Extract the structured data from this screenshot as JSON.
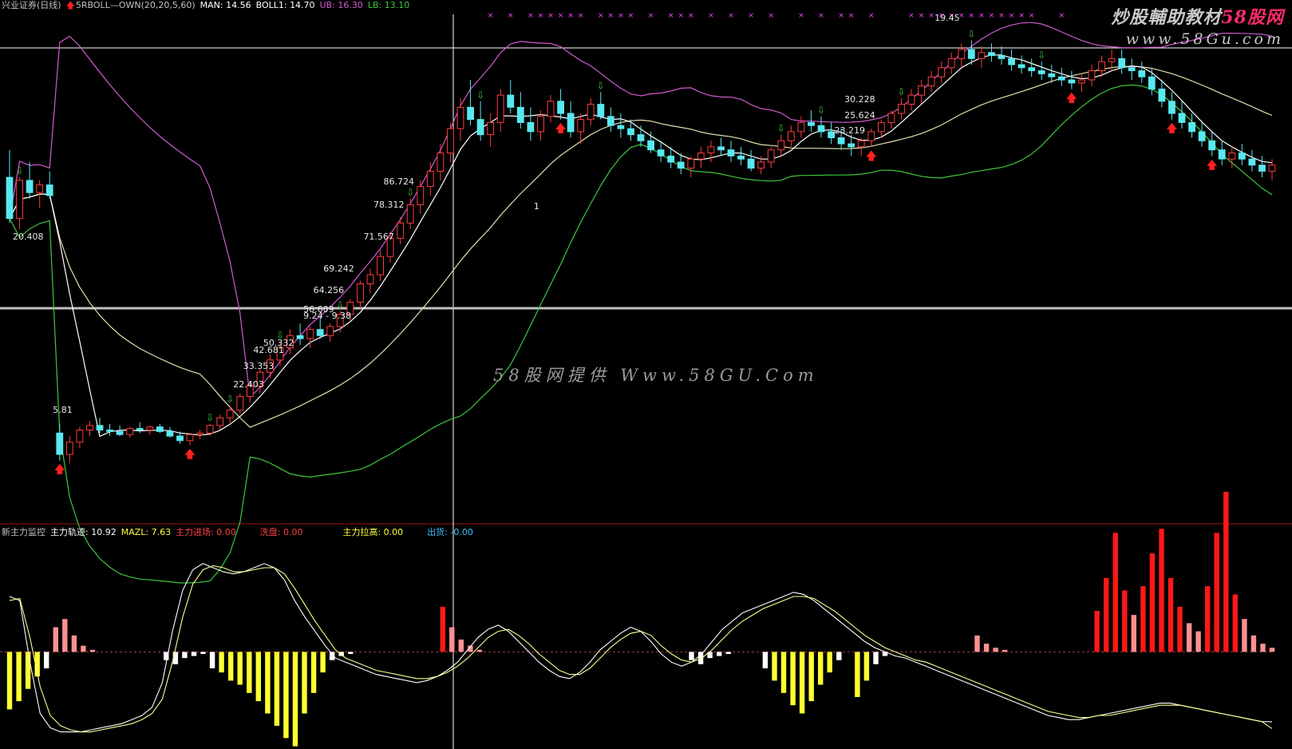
{
  "header": {
    "stock_name": "兴业证券(日线)",
    "indicator_name": "5RBOLL—OWN(20,20,5,60)",
    "man": "MAN: 14.56",
    "boll1": "BOLL1: 14.70",
    "ub": "UB: 16.30",
    "lb": "LB: 13.10"
  },
  "indicator_header": {
    "name": "新主力监控",
    "track": "主力轨迹: 10.92",
    "mazl": "MAZL: 7.63",
    "enter": "主力进场: 0.00",
    "washout": "洗盘: 0.00",
    "pullup": "主力拉高: 0.00",
    "ship": "出货: -0.00"
  },
  "watermarks": {
    "corner_line1_a": "炒股輔助教材",
    "corner_line1_b": "58股网",
    "corner_line2": "www.58Gu.com",
    "center": "58股网提供 Www.58GU.Com"
  },
  "colors": {
    "background": "#000000",
    "header_label": "#c0c0c0",
    "man": "#ffffff",
    "boll1": "#ffffff",
    "ub": "#d25ad2",
    "lb": "#3cc83c",
    "mid_line": "#e0e0b0",
    "up_candle": "#ff3c3c",
    "down_candle": "#58e8f0",
    "arrow_up": "#ff2020",
    "arrow_down": "#40c040",
    "x_marker": "#ff40ff",
    "red_bar": "#ff1818",
    "pink_bar": "#ff9090",
    "yellow_bar": "#ffff30",
    "white_bar": "#ffffff",
    "separator": "#a01818",
    "crosshair": "#ffffff",
    "price_cursor": "#c0c0c0",
    "enter": "#ff4040",
    "washout": "#ff4040",
    "pullup": "#ffff40",
    "ship": "#40c0ff"
  },
  "price_annotations": [
    "20.408",
    "5.81",
    "22.403",
    "33.353",
    "42.681",
    "50.332",
    "56.609",
    "9.24 - 9.38",
    "64.256",
    "69.242",
    "71.567",
    "78.312",
    "86.724",
    "1",
    "30.228",
    "25.624",
    "23.219",
    "19.45"
  ],
  "chart_data": [
    {
      "type": "candlestick",
      "title": "5RBOLL—OWN(20,20,5,60)",
      "units": "price (pixel-estimated; axis labels not shown)",
      "bands": [
        "UB",
        "BOLL1",
        "LB",
        "MAN"
      ],
      "candles": [
        [
          15.7,
          16.6,
          14.2,
          14.35
        ],
        [
          14.35,
          15.7,
          14.0,
          15.6
        ],
        [
          15.6,
          16.2,
          15.0,
          15.2
        ],
        [
          15.2,
          15.6,
          14.7,
          15.45
        ],
        [
          15.45,
          15.9,
          15.0,
          15.1
        ],
        [
          7.3,
          7.6,
          6.4,
          6.6
        ],
        [
          6.6,
          7.2,
          6.3,
          7.0
        ],
        [
          7.0,
          7.5,
          6.8,
          7.4
        ],
        [
          7.4,
          7.7,
          7.2,
          7.55
        ],
        [
          7.55,
          7.8,
          7.3,
          7.4
        ],
        [
          7.4,
          7.6,
          7.2,
          7.35
        ],
        [
          7.35,
          7.55,
          7.2,
          7.25
        ],
        [
          7.25,
          7.5,
          7.15,
          7.45
        ],
        [
          7.45,
          7.65,
          7.3,
          7.4
        ],
        [
          7.4,
          7.55,
          7.25,
          7.5
        ],
        [
          7.5,
          7.6,
          7.3,
          7.35
        ],
        [
          7.35,
          7.5,
          7.15,
          7.2
        ],
        [
          7.2,
          7.35,
          6.95,
          7.05
        ],
        [
          7.05,
          7.3,
          6.9,
          7.25
        ],
        [
          7.25,
          7.4,
          7.1,
          7.3
        ],
        [
          7.3,
          7.6,
          7.2,
          7.55
        ],
        [
          7.55,
          7.9,
          7.4,
          7.8
        ],
        [
          7.8,
          8.2,
          7.6,
          8.05
        ],
        [
          8.05,
          8.6,
          7.9,
          8.5
        ],
        [
          8.5,
          9.0,
          8.3,
          8.85
        ],
        [
          8.85,
          9.4,
          8.6,
          9.3
        ],
        [
          9.3,
          9.9,
          9.1,
          9.7
        ],
        [
          9.7,
          10.3,
          9.5,
          10.1
        ],
        [
          10.1,
          10.7,
          9.9,
          10.5
        ],
        [
          10.5,
          10.9,
          10.2,
          10.4
        ],
        [
          10.4,
          10.8,
          10.1,
          10.7
        ],
        [
          10.7,
          11.1,
          10.4,
          10.5
        ],
        [
          10.5,
          10.9,
          10.3,
          10.8
        ],
        [
          10.8,
          11.3,
          10.6,
          11.2
        ],
        [
          11.2,
          11.7,
          11.0,
          11.6
        ],
        [
          11.6,
          12.3,
          11.4,
          12.2
        ],
        [
          12.2,
          12.7,
          11.9,
          12.5
        ],
        [
          12.5,
          13.3,
          12.3,
          13.1
        ],
        [
          13.1,
          13.9,
          12.9,
          13.7
        ],
        [
          13.7,
          14.4,
          13.5,
          14.2
        ],
        [
          14.2,
          15.0,
          14.0,
          14.8
        ],
        [
          14.8,
          15.6,
          14.5,
          15.4
        ],
        [
          15.4,
          16.2,
          15.1,
          15.9
        ],
        [
          15.9,
          16.8,
          15.6,
          16.5
        ],
        [
          16.5,
          17.5,
          16.2,
          17.3
        ],
        [
          17.3,
          18.3,
          16.9,
          18.0
        ],
        [
          18.0,
          18.9,
          17.4,
          17.6
        ],
        [
          17.6,
          18.2,
          16.9,
          17.1
        ],
        [
          17.1,
          17.8,
          16.7,
          17.5
        ],
        [
          17.5,
          18.6,
          17.2,
          18.4
        ],
        [
          18.4,
          18.9,
          17.8,
          18.0
        ],
        [
          18.0,
          18.5,
          17.3,
          17.5
        ],
        [
          17.5,
          18.0,
          16.9,
          17.2
        ],
        [
          17.2,
          17.9,
          16.9,
          17.7
        ],
        [
          17.7,
          18.4,
          17.5,
          18.2
        ],
        [
          18.2,
          18.6,
          17.6,
          17.8
        ],
        [
          17.8,
          18.2,
          17.0,
          17.2
        ],
        [
          17.2,
          17.8,
          16.8,
          17.6
        ],
        [
          17.6,
          18.3,
          17.4,
          18.1
        ],
        [
          18.1,
          18.5,
          17.6,
          17.7
        ],
        [
          17.7,
          18.0,
          17.2,
          17.4
        ],
        [
          17.4,
          17.8,
          17.0,
          17.3
        ],
        [
          17.3,
          17.6,
          16.9,
          17.1
        ],
        [
          17.1,
          17.4,
          16.7,
          16.9
        ],
        [
          16.9,
          17.2,
          16.5,
          16.6
        ],
        [
          16.6,
          16.9,
          16.2,
          16.4
        ],
        [
          16.4,
          16.7,
          16.0,
          16.2
        ],
        [
          16.2,
          16.5,
          15.8,
          16.0
        ],
        [
          16.0,
          16.4,
          15.7,
          16.3
        ],
        [
          16.3,
          16.7,
          16.0,
          16.5
        ],
        [
          16.5,
          16.9,
          16.2,
          16.7
        ],
        [
          16.7,
          17.0,
          16.4,
          16.6
        ],
        [
          16.6,
          16.9,
          16.2,
          16.4
        ],
        [
          16.4,
          16.7,
          16.1,
          16.3
        ],
        [
          16.3,
          16.6,
          15.9,
          16.0
        ],
        [
          16.0,
          16.4,
          15.8,
          16.2
        ],
        [
          16.2,
          16.7,
          16.0,
          16.6
        ],
        [
          16.6,
          17.1,
          16.4,
          16.9
        ],
        [
          16.9,
          17.4,
          16.7,
          17.2
        ],
        [
          17.2,
          17.7,
          17.0,
          17.5
        ],
        [
          17.5,
          17.9,
          17.2,
          17.4
        ],
        [
          17.4,
          17.7,
          17.0,
          17.2
        ],
        [
          17.2,
          17.5,
          16.8,
          17.0
        ],
        [
          17.0,
          17.3,
          16.6,
          16.8
        ],
        [
          16.8,
          17.1,
          16.4,
          16.7
        ],
        [
          16.7,
          17.0,
          16.4,
          16.9
        ],
        [
          16.9,
          17.3,
          16.7,
          17.2
        ],
        [
          17.2,
          17.6,
          17.0,
          17.5
        ],
        [
          17.5,
          17.9,
          17.3,
          17.8
        ],
        [
          17.8,
          18.3,
          17.6,
          18.1
        ],
        [
          18.1,
          18.6,
          17.9,
          18.4
        ],
        [
          18.4,
          18.9,
          18.1,
          18.7
        ],
        [
          18.7,
          19.2,
          18.5,
          19.0
        ],
        [
          19.0,
          19.5,
          18.8,
          19.3
        ],
        [
          19.3,
          19.8,
          19.1,
          19.6
        ],
        [
          19.6,
          20.1,
          19.3,
          19.9
        ],
        [
          19.9,
          20.2,
          19.4,
          19.6
        ],
        [
          19.6,
          20.0,
          19.3,
          19.8
        ],
        [
          19.8,
          20.1,
          19.5,
          19.7
        ],
        [
          19.7,
          20.0,
          19.4,
          19.6
        ],
        [
          19.6,
          19.9,
          19.2,
          19.4
        ],
        [
          19.4,
          19.7,
          19.1,
          19.3
        ],
        [
          19.3,
          19.6,
          19.0,
          19.2
        ],
        [
          19.2,
          19.5,
          18.9,
          19.1
        ],
        [
          19.1,
          19.4,
          18.8,
          19.0
        ],
        [
          19.0,
          19.3,
          18.7,
          18.9
        ],
        [
          18.9,
          19.2,
          18.6,
          18.8
        ],
        [
          18.8,
          19.1,
          18.5,
          18.9
        ],
        [
          18.9,
          19.4,
          18.7,
          19.2
        ],
        [
          19.2,
          19.7,
          19.0,
          19.5
        ],
        [
          19.5,
          19.9,
          19.2,
          19.6
        ],
        [
          19.6,
          19.9,
          19.1,
          19.3
        ],
        [
          19.3,
          19.6,
          18.9,
          19.2
        ],
        [
          19.2,
          19.5,
          18.8,
          19.0
        ],
        [
          19.0,
          19.3,
          18.4,
          18.6
        ],
        [
          18.6,
          18.9,
          18.0,
          18.2
        ],
        [
          18.2,
          18.5,
          17.6,
          17.8
        ],
        [
          17.8,
          18.2,
          17.3,
          17.5
        ],
        [
          17.5,
          17.8,
          17.0,
          17.2
        ],
        [
          17.2,
          17.5,
          16.7,
          16.9
        ],
        [
          16.9,
          17.2,
          16.4,
          16.6
        ],
        [
          16.6,
          16.9,
          16.1,
          16.3
        ],
        [
          16.3,
          16.7,
          16.0,
          16.5
        ],
        [
          16.5,
          16.8,
          16.1,
          16.3
        ],
        [
          16.3,
          16.6,
          15.9,
          16.1
        ],
        [
          16.1,
          16.4,
          15.7,
          15.9
        ],
        [
          15.9,
          16.3,
          15.6,
          16.1
        ]
      ]
    },
    {
      "type": "line+bar",
      "title": "新主力监控",
      "series": [
        {
          "name": "主力轨迹",
          "values": [
            72,
            70,
            40,
            15,
            8,
            6,
            6,
            6,
            7,
            8,
            9,
            10,
            12,
            14,
            18,
            30,
            55,
            75,
            85,
            88,
            86,
            84,
            83,
            84,
            86,
            88,
            86,
            80,
            70,
            62,
            55,
            48,
            42,
            40,
            38,
            36,
            34,
            33,
            32,
            31,
            30,
            31,
            33,
            36,
            40,
            46,
            52,
            56,
            58,
            55,
            50,
            45,
            40,
            36,
            33,
            32,
            35,
            40,
            46,
            50,
            54,
            57,
            55,
            50,
            44,
            40,
            38,
            40,
            44,
            50,
            56,
            60,
            64,
            66,
            68,
            70,
            72,
            74,
            73,
            70,
            66,
            62,
            58,
            54,
            50,
            47,
            45,
            43,
            42,
            40,
            38,
            36,
            34,
            32,
            30,
            28,
            26,
            24,
            22,
            20,
            18,
            16,
            14,
            13,
            12,
            12,
            13,
            14,
            15,
            16,
            17,
            18,
            19,
            20,
            20,
            19,
            18,
            17,
            16,
            15,
            14,
            13,
            12,
            11,
            10.92
          ]
        },
        {
          "name": "MAZL",
          "values": [
            70,
            71,
            52,
            28,
            14,
            9,
            7,
            6,
            6,
            7,
            8,
            9,
            10,
            12,
            15,
            22,
            40,
            62,
            78,
            85,
            87,
            86,
            84,
            84,
            85,
            86,
            86,
            83,
            76,
            68,
            60,
            53,
            46,
            42,
            40,
            38,
            36,
            35,
            34,
            33,
            32,
            32,
            33,
            35,
            38,
            42,
            47,
            52,
            55,
            56,
            53,
            49,
            44,
            40,
            36,
            34,
            34,
            37,
            42,
            47,
            51,
            54,
            55,
            53,
            48,
            44,
            41,
            40,
            42,
            46,
            51,
            56,
            60,
            63,
            66,
            68,
            70,
            72,
            72,
            71,
            68,
            65,
            61,
            57,
            53,
            50,
            47,
            45,
            43,
            41,
            40,
            38,
            36,
            34,
            32,
            30,
            28,
            26,
            24,
            22,
            20,
            18,
            16,
            15,
            14,
            13,
            13,
            14,
            14,
            15,
            16,
            17,
            18,
            19,
            19,
            19,
            18,
            17,
            16,
            15,
            14,
            13,
            12,
            11,
            7.63
          ]
        }
      ],
      "bars": [
        -28,
        -24,
        -18,
        -12,
        -8,
        12,
        16,
        8,
        3,
        1,
        0,
        0,
        0,
        0,
        0,
        0,
        0,
        -4,
        -6,
        -3,
        -2,
        -1,
        -8,
        -10,
        -14,
        -16,
        -20,
        -24,
        -30,
        -36,
        -42,
        -46,
        -30,
        -20,
        -10,
        -4,
        -2,
        -1,
        0,
        0,
        0,
        0,
        0,
        0,
        0,
        0,
        0,
        22,
        12,
        6,
        3,
        1,
        0,
        0,
        0,
        0,
        0,
        0,
        0,
        0,
        0,
        0,
        0,
        0,
        0,
        0,
        0,
        0,
        0,
        0,
        0,
        0,
        0,
        0,
        -4,
        -6,
        -3,
        -2,
        -1,
        0,
        0,
        0,
        -8,
        -14,
        -20,
        -26,
        -30,
        -24,
        -16,
        -10,
        -4,
        0,
        -22,
        -14,
        -6,
        -2,
        0,
        0,
        0,
        0,
        0,
        0,
        0,
        0,
        0,
        8,
        4,
        2,
        1,
        0,
        0,
        0,
        0,
        0,
        0,
        0,
        0,
        0,
        20,
        36,
        58,
        30,
        18,
        32,
        48,
        60,
        36,
        22,
        14,
        10,
        32,
        58,
        78,
        28,
        16,
        8,
        4,
        2
      ]
    }
  ]
}
